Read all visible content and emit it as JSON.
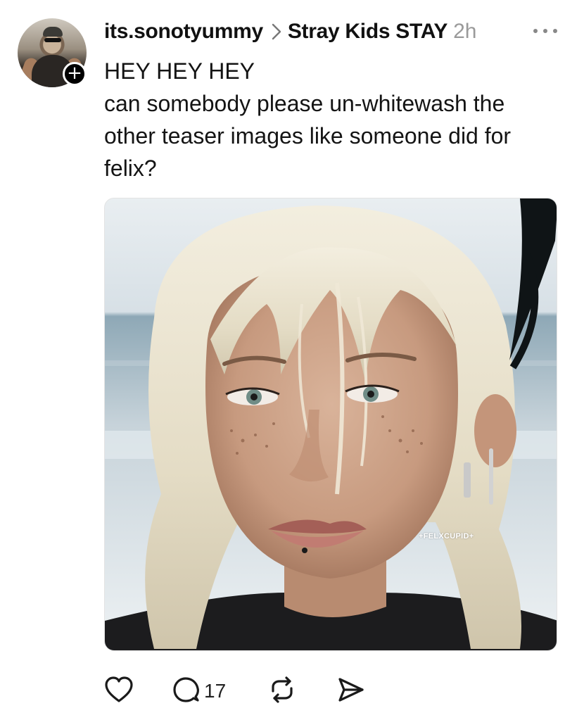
{
  "post": {
    "username": "its.sonotyummy",
    "community": "Stray Kids STAY",
    "time": "2h",
    "text_lines": [
      "HEY HEY HEY",
      "can somebody please un-whitewash the other teaser images like someone did for felix?"
    ],
    "image": {
      "watermark": "+FELXCUPID+"
    },
    "actions": {
      "like_icon": "heart-icon",
      "reply_icon": "comment-icon",
      "reply_count": "17",
      "repost_icon": "repost-icon",
      "share_icon": "send-icon"
    }
  },
  "colors": {
    "text": "#111111",
    "muted": "#9a9a9a",
    "background": "#ffffff"
  }
}
